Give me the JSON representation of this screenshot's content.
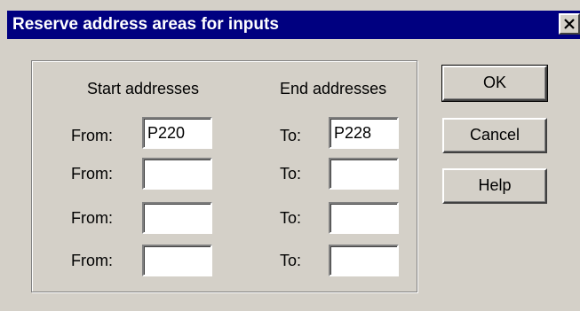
{
  "dialog": {
    "title": "Reserve address areas for inputs"
  },
  "group": {
    "start_header": "Start addresses",
    "end_header": "End addresses",
    "from_label": "From:",
    "to_label": "To:",
    "rows": [
      {
        "from": "P220",
        "to": "P228"
      },
      {
        "from": "",
        "to": ""
      },
      {
        "from": "",
        "to": ""
      },
      {
        "from": "",
        "to": ""
      }
    ]
  },
  "buttons": {
    "ok": "OK",
    "cancel": "Cancel",
    "help": "Help"
  },
  "icons": {
    "close": "close-icon"
  }
}
